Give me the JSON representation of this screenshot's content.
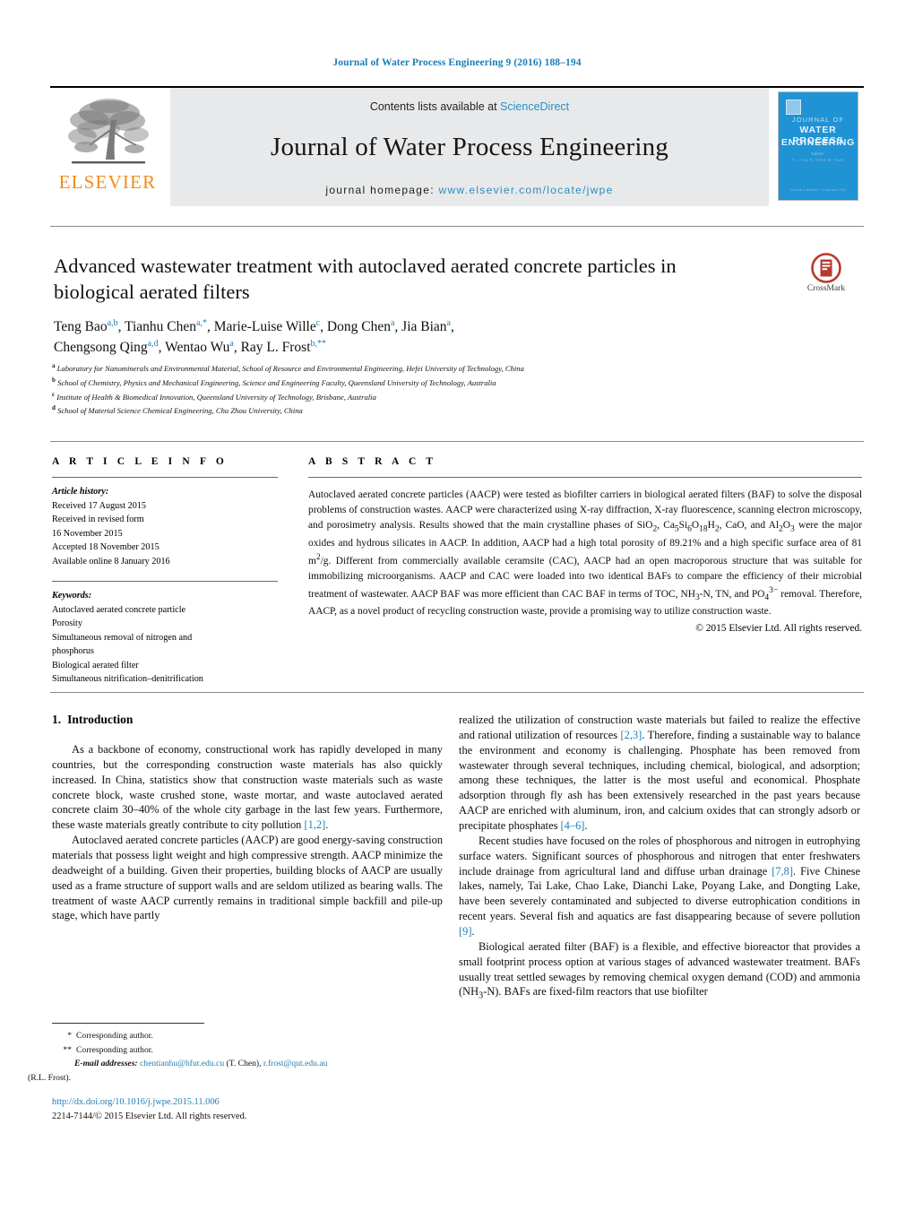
{
  "running_head": "Journal of Water Process Engineering 9 (2016) 188–194",
  "masthead": {
    "publisher_word": "ELSEVIER",
    "contents_prefix": "Contents lists available at ",
    "contents_link": "ScienceDirect",
    "journal_title": "Journal of Water Process Engineering",
    "homepage_prefix": "journal homepage: ",
    "homepage_url": "www.elsevier.com/locate/jwpe",
    "cover": {
      "line0": "JOURNAL OF",
      "line1": "WATER PROCESS",
      "line2": "ENGINEERING",
      "sub1": "Editor:",
      "sub2": "F. I. Hai    R. Field    W. Yuan",
      "footer": "Volume 1  Number 1  February 2014"
    }
  },
  "article": {
    "title": "Advanced wastewater treatment with autoclaved aerated concrete particles in biological aerated filters",
    "crossmark_label": "CrossMark",
    "authors_line1": "Teng Bao",
    "authors": [
      {
        "name": "Teng Bao",
        "marks": "a,b"
      },
      {
        "name": "Tianhu Chen",
        "marks": "a,*"
      },
      {
        "name": "Marie-Luise Wille",
        "marks": "c"
      },
      {
        "name": "Dong Chen",
        "marks": "a"
      },
      {
        "name": "Jia Bian",
        "marks": "a"
      },
      {
        "name": "Chengsong Qing",
        "marks": "a,d"
      },
      {
        "name": "Wentao Wu",
        "marks": "a"
      },
      {
        "name": "Ray L. Frost",
        "marks": "b,**"
      }
    ],
    "affiliations": [
      {
        "mark": "a",
        "text": "Laboratory for Nanominerals and Environmental Material, School of Resource and Environmental Engineering, Hefei University of Technology, China"
      },
      {
        "mark": "b",
        "text": "School of Chemistry, Physics and Mechanical Engineering, Science and Engineering Faculty, Queensland University of Technology, Australia"
      },
      {
        "mark": "c",
        "text": "Institute of Health & Biomedical Innovation, Queensland University of Technology, Brisbane, Australia"
      },
      {
        "mark": "d",
        "text": "School of Material Science Chemical Engineering, Chu Zhou University, China"
      }
    ]
  },
  "article_info": {
    "heading": "A R T I C L E    I N F O",
    "history_label": "Article history:",
    "history": [
      "Received 17 August 2015",
      "Received in revised form",
      "16 November 2015",
      "Accepted 18 November 2015",
      "Available online 8 January 2016"
    ],
    "keywords_label": "Keywords:",
    "keywords": [
      "Autoclaved aerated concrete particle",
      "Porosity",
      "Simultaneous removal of nitrogen and",
      "phosphorus",
      "Biological aerated filter",
      "Simultaneous nitrification–denitrification"
    ]
  },
  "abstract": {
    "heading": "A B S T R A C T",
    "text": "Autoclaved aerated concrete particles (AACP) were tested as biofilter carriers in biological aerated filters (BAF) to solve the disposal problems of construction wastes. AACP were characterized using X-ray diffraction, X-ray fluorescence, scanning electron microscopy, and porosimetry analysis. Results showed that the main crystalline phases of SiO2, Ca5Si6O18H2, CaO, and Al2O3 were the major oxides and hydrous silicates in AACP. In addition, AACP had a high total porosity of 89.21% and a high specific surface area of 81 m2/g. Different from commercially available ceramsite (CAC), AACP had an open macroporous structure that was suitable for immobilizing microorganisms. AACP and CAC were loaded into two identical BAFs to compare the efficiency of their microbial treatment of wastewater. AACP BAF was more efficient than CAC BAF in terms of TOC, NH3-N, TN, and PO43− removal. Therefore, AACP, as a novel product of recycling construction waste, provide a promising way to utilize construction waste.",
    "copyright": "© 2015 Elsevier Ltd. All rights reserved."
  },
  "body": {
    "section_number": "1.",
    "section_title": "Introduction",
    "left_paragraphs": [
      "As a backbone of economy, constructional work has rapidly developed in many countries, but the corresponding construction waste materials has also quickly increased. In China, statistics show that construction waste materials such as waste concrete block, waste crushed stone, waste mortar, and waste autoclaved aerated concrete claim 30–40% of the whole city garbage in the last few years. Furthermore, these waste materials greatly contribute to city pollution [1,2].",
      "Autoclaved aerated concrete particles (AACP) are good energy-saving construction materials that possess light weight and high compressive strength. AACP minimize the deadweight of a building. Given their properties, building blocks of AACP are usually used as a frame structure of support walls and are seldom utilized as bearing walls. The treatment of waste AACP currently remains in traditional simple backfill and pile-up stage, which have partly"
    ],
    "right_paragraphs": [
      "realized the utilization of construction waste materials but failed to realize the effective and rational utilization of resources [2,3]. Therefore, finding a sustainable way to balance the environment and economy is challenging. Phosphate has been removed from wastewater through several techniques, including chemical, biological, and adsorption; among these techniques, the latter is the most useful and economical. Phosphate adsorption through fly ash has been extensively researched in the past years because AACP are enriched with aluminum, iron, and calcium oxides that can strongly adsorb or precipitate phosphates [4–6].",
      "Recent studies have focused on the roles of phosphorous and nitrogen in eutrophying surface waters. Significant sources of phosphorous and nitrogen that enter freshwaters include drainage from agricultural land and diffuse urban drainage [7,8]. Five Chinese lakes, namely, Tai Lake, Chao Lake, Dianchi Lake, Poyang Lake, and Dongting Lake, have been severely contaminated and subjected to diverse eutrophication conditions in recent years. Several fish and aquatics are fast disappearing because of severe pollution [9].",
      "Biological aerated filter (BAF) is a flexible, and effective bioreactor that provides a small footprint process option at various stages of advanced wastewater treatment. BAFs usually treat settled sewages by removing chemical oxygen demand (COD) and ammonia (NH3-N). BAFs are fixed-film reactors that use biofilter"
    ]
  },
  "footnotes": {
    "corresponding_1_mark": "*",
    "corresponding_1": "Corresponding author.",
    "corresponding_2_mark": "**",
    "corresponding_2": "Corresponding author.",
    "email_label": "E-mail addresses:",
    "email_1": "chentianhu@hfut.edu.cu",
    "email_1_owner": "(T. Chen),",
    "email_2": "r.frost@qut.edu.au",
    "email_2_owner": "(R.L. Frost)."
  },
  "footer": {
    "doi": "http://dx.doi.org/10.1016/j.jwpe.2015.11.006",
    "issn_line": "2214-7144/© 2015 Elsevier Ltd. All rights reserved."
  },
  "colors": {
    "link": "#1f7fb4",
    "elsevier_orange": "#f08c1b",
    "band_grey": "#e8e9ea",
    "cover_blue": "#1f93d4",
    "crossmark_red": "#c0392b"
  }
}
